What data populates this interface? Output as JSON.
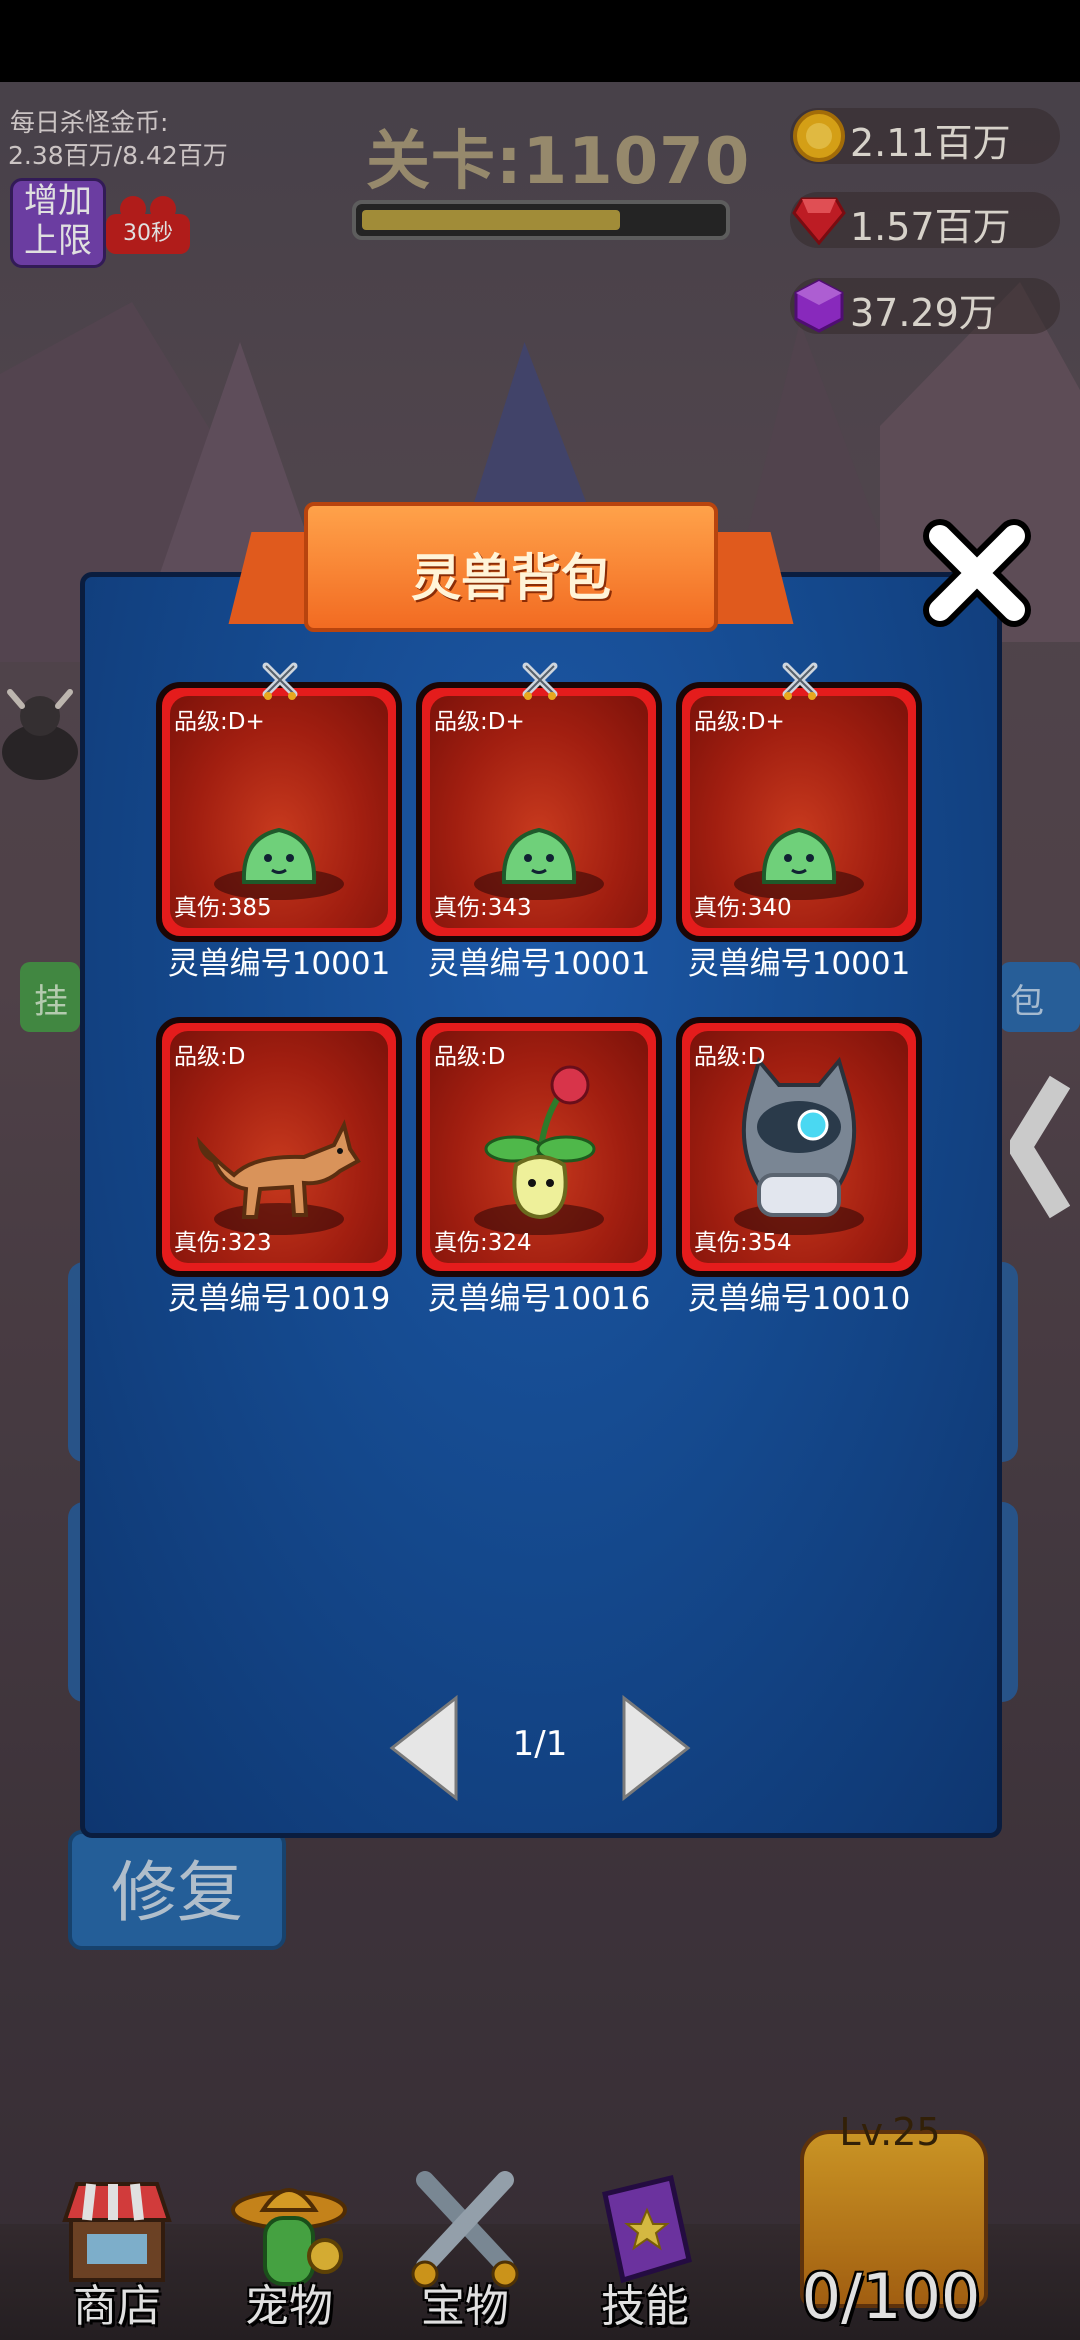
{
  "hud": {
    "daily_coin_label": "每日杀怪金币:",
    "daily_coin_value": "2.38百万/8.42百万",
    "stage_label": "关卡:11070",
    "stage_progress": 0.72,
    "increase_limit": [
      "增加",
      "上限"
    ],
    "video_timer": "30秒",
    "resources": [
      {
        "icon": "gold-coin-icon",
        "value": "2.11百万"
      },
      {
        "icon": "red-gem-icon",
        "value": "1.57百万"
      },
      {
        "icon": "purple-gem-icon",
        "value": "37.29万"
      }
    ]
  },
  "background": {
    "repair_label": "修复",
    "left_tab_fragment": "挂",
    "right_tab_fragment": "包"
  },
  "modal": {
    "title": "灵兽背包",
    "pets": [
      {
        "grade": "品级:D+",
        "damage": "真伤:385",
        "name": "灵兽编号10001",
        "equipped": true,
        "creature": "green-slime-icon"
      },
      {
        "grade": "品级:D+",
        "damage": "真伤:343",
        "name": "灵兽编号10001",
        "equipped": true,
        "creature": "green-slime-icon"
      },
      {
        "grade": "品级:D+",
        "damage": "真伤:340",
        "name": "灵兽编号10001",
        "equipped": true,
        "creature": "green-slime-icon"
      },
      {
        "grade": "品级:D",
        "damage": "真伤:323",
        "name": "灵兽编号10019",
        "equipped": false,
        "creature": "fox-icon"
      },
      {
        "grade": "品级:D",
        "damage": "真伤:324",
        "name": "灵兽编号10016",
        "equipped": false,
        "creature": "rose-plant-icon"
      },
      {
        "grade": "品级:D",
        "damage": "真伤:354",
        "name": "灵兽编号10010",
        "equipped": false,
        "creature": "armored-cat-icon"
      }
    ],
    "page": "1/1"
  },
  "bottom_nav": {
    "tabs": [
      {
        "label": "商店",
        "icon": "shop-icon"
      },
      {
        "label": "宠物",
        "icon": "pet-icon"
      },
      {
        "label": "宝物",
        "icon": "swords-icon"
      },
      {
        "label": "技能",
        "icon": "skill-book-icon"
      }
    ],
    "chest_level": "Lv.25",
    "chest_count": "0/100"
  },
  "colors": {
    "modal_blue": "#154a8f",
    "ribbon_orange": "#f26b22",
    "card_red": "#e41c1c"
  }
}
